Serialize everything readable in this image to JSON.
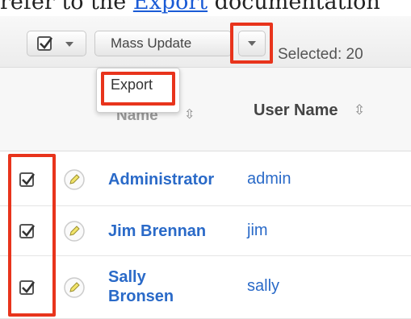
{
  "doc": {
    "prefix": "refer to the ",
    "link": "Export",
    "suffix": " documentation"
  },
  "toolbar": {
    "mass_update_label": "Mass Update",
    "selected_label": "Selected: 20"
  },
  "menu": {
    "items": [
      "Export"
    ]
  },
  "table": {
    "headers": {
      "name": "Name",
      "user_name": "User Name"
    },
    "rows": [
      {
        "name": "Administrator",
        "user_name": "admin",
        "checked": true
      },
      {
        "name": "Jim Brennan",
        "user_name": "jim",
        "checked": true
      },
      {
        "name": "Sally Bronsen",
        "name_line1": "Sally",
        "name_line2": "Bronsen",
        "user_name": "sally",
        "checked": true
      }
    ]
  },
  "colors": {
    "highlight": "#e8341c",
    "link": "#2a6ac8",
    "pencil": "#f2e46a"
  },
  "icons": {
    "checkbox": "checkbox-checked-icon",
    "caret": "caret-down-icon",
    "sort": "sort-arrows-icon",
    "edit": "pencil-icon"
  }
}
